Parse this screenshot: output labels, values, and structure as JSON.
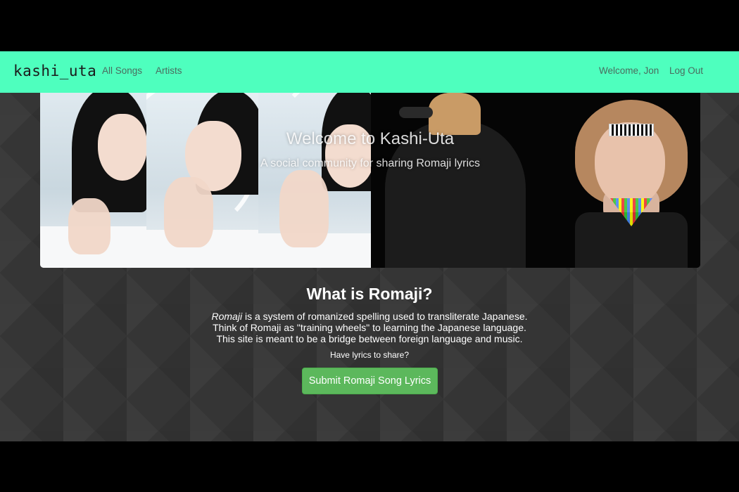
{
  "navbar": {
    "brand": "kashi_uta",
    "links": [
      {
        "label": "All Songs"
      },
      {
        "label": "Artists"
      }
    ],
    "welcome": "Welcome, Jon",
    "logout": "Log Out",
    "background_color": "#4effbe"
  },
  "hero": {
    "title": "Welcome to Kashi-Uta",
    "subtitle": "A social community for sharing Romaji lyrics"
  },
  "about": {
    "title": "What is Romaji?",
    "term": "Romaji",
    "line1_rest": " is a system of romanized spelling used to transliterate Japanese.",
    "line2": "Think of Romaji as \"training wheels\" to learning the Japanese language.",
    "line3": "This site is meant to be a bridge between foreign language and music.",
    "share_question": "Have lyrics to share?",
    "submit_label": "Submit Romaji Song Lyrics",
    "submit_color": "#5cb85c"
  }
}
